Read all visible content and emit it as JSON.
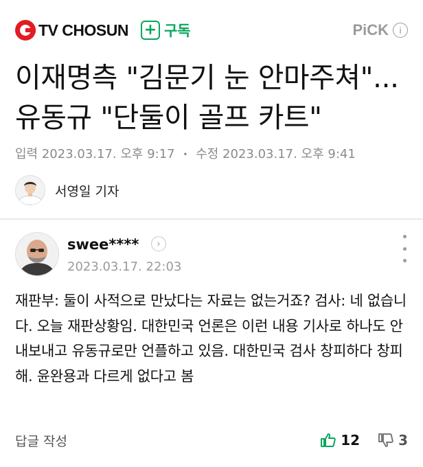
{
  "header": {
    "brand_name": "TV CHOSUN",
    "subscribe_plus": "+",
    "subscribe_label": "구독",
    "pick_label": "PiCK",
    "info_glyph": "i"
  },
  "article": {
    "headline": "이재명측 \"김문기 눈 안마주쳐\"...유동규 \"단둘이 골프 카트\"",
    "published_label": "입력",
    "published_time": "2023.03.17. 오후 9:17",
    "modified_label": "수정",
    "modified_time": "2023.03.17. 오후 9:41",
    "reporter": "서영일 기자"
  },
  "comment": {
    "username": "swee****",
    "date": "2023.03.17. 22:03",
    "text": "재판부: 둘이 사적으로 만났다는 자료는 없는거죠? 검사: 네 없습니다. 오늘 재판상황임. 대한민국 언론은 이런 내용 기사로 하나도 안 내보내고 유동규로만 언플하고 있음. 대한민국 검사 창피하다 창피해. 윤완용과 다르게 없다고 봄",
    "reply_label": "답글 작성",
    "like_count": "12",
    "dislike_count": "3"
  },
  "colors": {
    "brand_red": "#e31b23",
    "subscribe_green": "#07a65c",
    "like_green": "#07a65c",
    "meta_gray": "#8a8a8a"
  },
  "icons": {
    "brand": "tv-chosun-logo-icon",
    "info": "info-icon",
    "chevron": "chevron-right-icon",
    "more": "more-vertical-icon",
    "like": "thumbs-up-icon",
    "dislike": "thumbs-down-icon"
  }
}
